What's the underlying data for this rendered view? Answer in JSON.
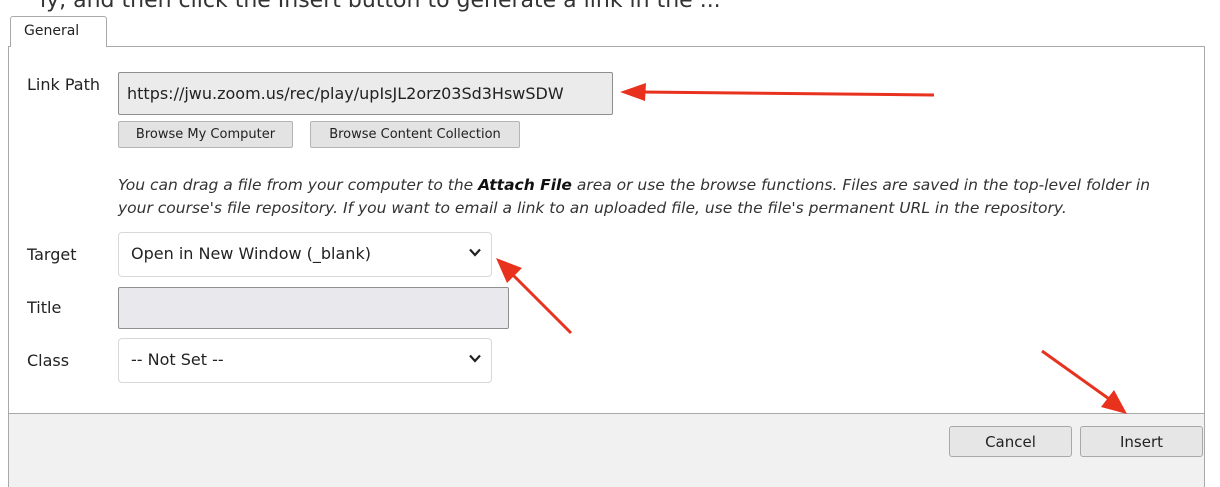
{
  "top_cutoff_text": "ly, and then click the Insert button to generate a link in the ...",
  "tabs": [
    {
      "label": "General"
    }
  ],
  "link_path": {
    "label": "Link Path",
    "value": "https://jwu.zoom.us/rec/play/upIsJL2orz03Sd3HswSDW",
    "browse_computer": "Browse My Computer",
    "browse_collection": "Browse Content Collection"
  },
  "help": {
    "before": "You can drag a file from your computer to the ",
    "bold": "Attach File",
    "after": " area or use the browse functions. Files are saved in the top-level folder in your course's file repository. If you want to email a link to an uploaded file, use the file's permanent URL in the repository."
  },
  "target": {
    "label": "Target",
    "value": "Open in New Window (_blank)"
  },
  "title": {
    "label": "Title",
    "value": ""
  },
  "class": {
    "label": "Class",
    "value": "-- Not Set --"
  },
  "buttons": {
    "cancel": "Cancel",
    "insert": "Insert"
  },
  "colors": {
    "annotation_arrow": "#e8321e",
    "panel_border": "#a9a9a9",
    "footer_bg": "#f1f1f1"
  }
}
